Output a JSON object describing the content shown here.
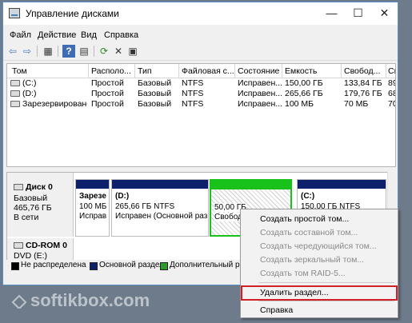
{
  "window": {
    "title": "Управление дисками",
    "controls": {
      "minimize": "—",
      "maximize": "☐",
      "close": "✕"
    }
  },
  "menu": [
    "Файл",
    "Действие",
    "Вид",
    "Справка"
  ],
  "toolbar": {
    "icons": [
      "back-icon",
      "forward-icon",
      "grid-icon",
      "help-icon",
      "list-icon",
      "refresh-icon",
      "delete-icon",
      "properties-icon"
    ],
    "glyphs": {
      "back": "⇦",
      "forward": "⇨",
      "grid": "▦",
      "help": "?",
      "list": "▤",
      "refresh": "⟳",
      "delete": "✕",
      "properties": "▣"
    }
  },
  "volumes": {
    "columns": [
      "Том",
      "Располо...",
      "Тип",
      "Файловая с...",
      "Состояние",
      "Емкость",
      "Свобод...",
      "Св"
    ],
    "rows": [
      [
        "(C:)",
        "Простой",
        "Базовый",
        "NTFS",
        "Исправен...",
        "150,00 ГБ",
        "133,84 ГБ",
        "89"
      ],
      [
        "(D:)",
        "Простой",
        "Базовый",
        "NTFS",
        "Исправен...",
        "265,66 ГБ",
        "179,76 ГБ",
        "68"
      ],
      [
        "Зарезервировано...",
        "Простой",
        "Базовый",
        "NTFS",
        "Исправен...",
        "100 МБ",
        "70 МБ",
        "70"
      ]
    ]
  },
  "disk0": {
    "name": "Диск 0",
    "type": "Базовый",
    "size": "465,76 ГБ",
    "status": "В сети",
    "partitions": [
      {
        "title": "Зарезе",
        "size": "100 МБ",
        "status": "Исправ"
      },
      {
        "title": "(D:)",
        "size": "265,66 ГБ NTFS",
        "status": "Исправен (Основной раз"
      },
      {
        "title": "",
        "size": "50,00 ГБ",
        "status": "Свобод"
      },
      {
        "title": "(C:)",
        "size": "150,00 ГБ NTFS",
        "status": ""
      }
    ]
  },
  "cdrom": {
    "name": "CD-ROM 0",
    "drive": "DVD (E:)"
  },
  "legend": [
    {
      "label": "Не распределена",
      "color": "#000000"
    },
    {
      "label": "Основной раздел",
      "color": "#0e1f6b"
    },
    {
      "label": "Дополнительный ра",
      "color": "#2a9a2a"
    }
  ],
  "context_menu": [
    "Создать простой том...",
    "Создать составной том...",
    "Создать чередующийся том...",
    "Создать зеркальный том...",
    "Создать том RAID-5...",
    "Удалить раздел...",
    "Справка"
  ],
  "watermark": "softikbox.com",
  "colors": {
    "primary_partition": "#0e1f6b",
    "extended_partition": "#19c21a",
    "highlight": "#d21f26"
  }
}
